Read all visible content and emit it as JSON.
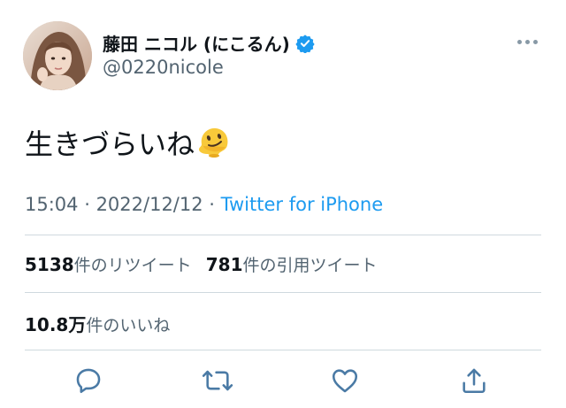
{
  "user": {
    "display_name": "藤田 ニコル (にこるん)",
    "handle": "@0220nicole",
    "verified_icon": "verified-badge-icon",
    "avatar": "profile-avatar"
  },
  "tweet": {
    "text": "生きづらいね",
    "emoji": "melting-face-emoji"
  },
  "meta": {
    "time": "15:04",
    "separator1": " · ",
    "date": "2022/12/12",
    "separator2": " · ",
    "source": "Twitter for iPhone"
  },
  "stats": {
    "retweets_count": "5138",
    "retweets_label": "件のリツイート",
    "quotes_count": "781",
    "quotes_label": "件の引用ツイート",
    "likes_count": "10.8万",
    "likes_label": "件のいいね"
  },
  "actions": [
    "reply-icon",
    "retweet-icon",
    "like-icon",
    "share-icon"
  ],
  "colors": {
    "accent": "#1d9bf0",
    "secondary_text": "#536471",
    "divider": "#cfd9de",
    "action_icon": "#4a7aa5"
  }
}
